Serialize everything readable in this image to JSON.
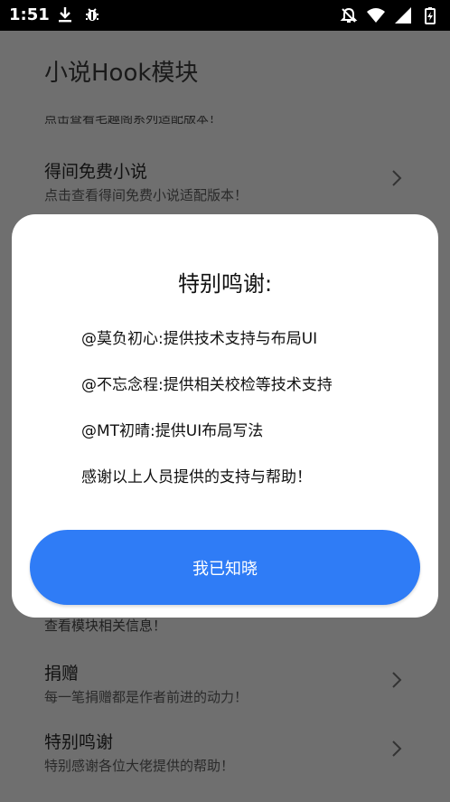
{
  "status_bar": {
    "time": "1:51",
    "left_icons": [
      "download-icon",
      "bug-icon"
    ],
    "right_icons": [
      "notifications-off-icon",
      "wifi-icon",
      "signal-icon",
      "battery-charging-icon"
    ]
  },
  "app": {
    "title": "小说Hook模块",
    "cut_subtitle": "点击查看毛趣阁系列适配版本！",
    "items": [
      {
        "title": "得间免费小说",
        "subtitle": "点击查看得间免费小说适配版本！"
      },
      {
        "title": "捐赠",
        "subtitle": "每一笔捐赠都是作者前进的动力！"
      },
      {
        "title": "特别鸣谢",
        "subtitle": "特别感谢各位大佬提供的帮助！"
      }
    ],
    "below_dialog_subtitle": "查看模块相关信息！"
  },
  "dialog": {
    "title": "特别鸣谢:",
    "lines": [
      "@莫负初心:提供技术支持与布局UI",
      "@不忘念程:提供相关校检等技术支持",
      "@MT初晴:提供UI布局写法",
      "感谢以上人员提供的支持与帮助！"
    ],
    "confirm_label": "我已知晓"
  },
  "colors": {
    "accent": "#2f7cf6",
    "scrim": "#6f6f6f",
    "dialog_bg": "#ffffff"
  }
}
